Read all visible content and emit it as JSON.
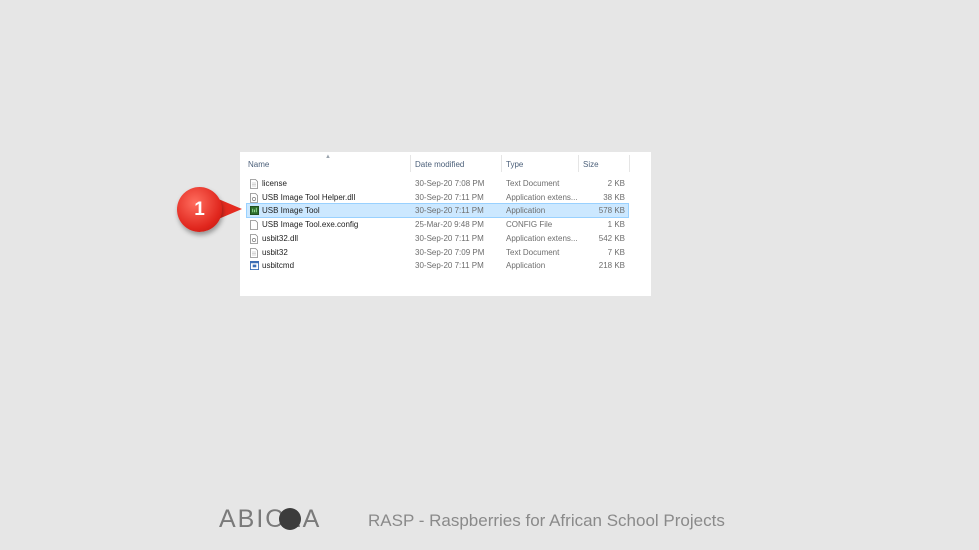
{
  "explorer": {
    "columns": {
      "name": "Name",
      "date_modified": "Date modified",
      "type": "Type",
      "size": "Size"
    },
    "files": [
      {
        "name": "license",
        "date": "30-Sep-20 7:08 PM",
        "type": "Text Document",
        "size": "2 KB",
        "icon": "text-file-icon",
        "selected": false
      },
      {
        "name": "USB Image Tool Helper.dll",
        "date": "30-Sep-20 7:11 PM",
        "type": "Application extens...",
        "size": "38 KB",
        "icon": "dll-file-icon",
        "selected": false
      },
      {
        "name": "USB Image Tool",
        "date": "30-Sep-20 7:11 PM",
        "type": "Application",
        "size": "578 KB",
        "icon": "usb-image-tool-app-icon",
        "selected": true
      },
      {
        "name": "USB Image Tool.exe.config",
        "date": "25-Mar-20 9:48 PM",
        "type": "CONFIG File",
        "size": "1 KB",
        "icon": "config-file-icon",
        "selected": false
      },
      {
        "name": "usbit32.dll",
        "date": "30-Sep-20 7:11 PM",
        "type": "Application extens...",
        "size": "542 KB",
        "icon": "dll-file-icon",
        "selected": false
      },
      {
        "name": "usbit32",
        "date": "30-Sep-20 7:09 PM",
        "type": "Text Document",
        "size": "7 KB",
        "icon": "text-file-icon",
        "selected": false
      },
      {
        "name": "usbitcmd",
        "date": "30-Sep-20 7:11 PM",
        "type": "Application",
        "size": "218 KB",
        "icon": "console-app-icon",
        "selected": false
      }
    ]
  },
  "callout": {
    "number": "1"
  },
  "footer": {
    "logo_text": "ABIOLA",
    "tagline": "RASP - Raspberries for African School Projects"
  },
  "colors": {
    "selection": "#cce8ff",
    "callout": "#e42b20",
    "background": "#e6e6e6"
  }
}
